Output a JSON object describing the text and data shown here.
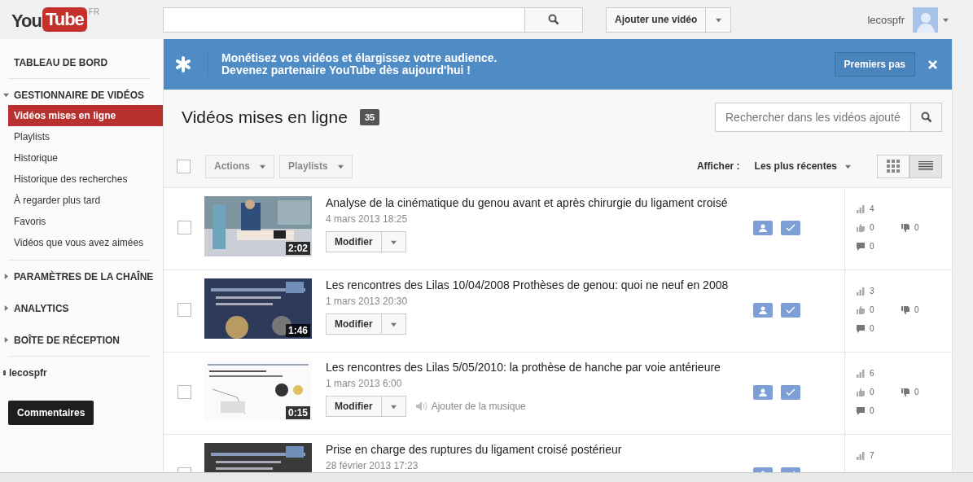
{
  "header": {
    "logo": {
      "you": "You",
      "tube": "Tube",
      "region": "FR"
    },
    "upload_button": "Ajouter une vidéo",
    "username": "lecospfr"
  },
  "sidebar": {
    "sections": [
      {
        "label": "TABLEAU DE BORD",
        "kind": "link"
      },
      {
        "label": "GESTIONNAIRE DE VIDÉOS",
        "kind": "group",
        "expanded": true,
        "children": [
          {
            "label": "Vidéos mises en ligne",
            "selected": true
          },
          {
            "label": "Playlists",
            "selected": false
          },
          {
            "label": "Historique",
            "selected": false
          },
          {
            "label": "Historique des recherches",
            "selected": false
          },
          {
            "label": "À regarder plus tard",
            "selected": false
          },
          {
            "label": "Favoris",
            "selected": false
          },
          {
            "label": "Vidéos que vous avez aimées",
            "selected": false
          }
        ]
      },
      {
        "label": "PARAMÈTRES DE LA CHAÎNE",
        "kind": "group",
        "expanded": false
      },
      {
        "label": "ANALYTICS",
        "kind": "group",
        "expanded": false
      },
      {
        "label": "BOÎTE DE RÉCEPTION",
        "kind": "group",
        "expanded": false
      }
    ],
    "account": "lecospfr",
    "feedback_button": "Commentaires"
  },
  "banner": {
    "line1": "Monétisez vos vidéos et élargissez votre audience.",
    "line2": "Devenez partenaire YouTube dès aujourd'hui !",
    "button": "Premiers pas"
  },
  "uploads": {
    "title": "Vidéos mises en ligne",
    "count": "35",
    "search_placeholder": "Rechercher dans les vidéos ajouté",
    "actions": "Actions",
    "playlists": "Playlists",
    "select_all_checked": false,
    "show_label": "Afficher :",
    "sort": "Les plus récentes",
    "view_modes": [
      {
        "kind": "grid",
        "selected": false
      },
      {
        "kind": "list",
        "selected": true
      }
    ],
    "videos": [
      {
        "title": "Analyse de la cinématique du genou avant et après chirurgie du ligament croisé",
        "date": "4 mars 2013 18:25",
        "duration": "2:02",
        "edit": "Modifier",
        "checked": false,
        "views": "4",
        "likes": "0",
        "dislikes": "0",
        "comments": "0"
      },
      {
        "title": "Les rencontres des Lilas 10/04/2008 Prothèses de genou: quoi ne neuf en 2008",
        "date": "1 mars 2013 20:30",
        "duration": "1:46",
        "edit": "Modifier",
        "checked": false,
        "views": "3",
        "likes": "0",
        "dislikes": "0",
        "comments": "0"
      },
      {
        "title": "Les rencontres des Lilas 5/05/2010: la prothèse de hanche par voie antérieure",
        "date": "1 mars 2013 6:00",
        "duration": "0:15",
        "edit": "Modifier",
        "checked": false,
        "music": "Ajouter de la musique",
        "views": "6",
        "likes": "0",
        "dislikes": "0",
        "comments": "0"
      },
      {
        "title": "Prise en charge des ruptures du ligament croisé postérieur",
        "date": "28 février 2013 17:23",
        "checked": false,
        "views": "7"
      }
    ]
  }
}
